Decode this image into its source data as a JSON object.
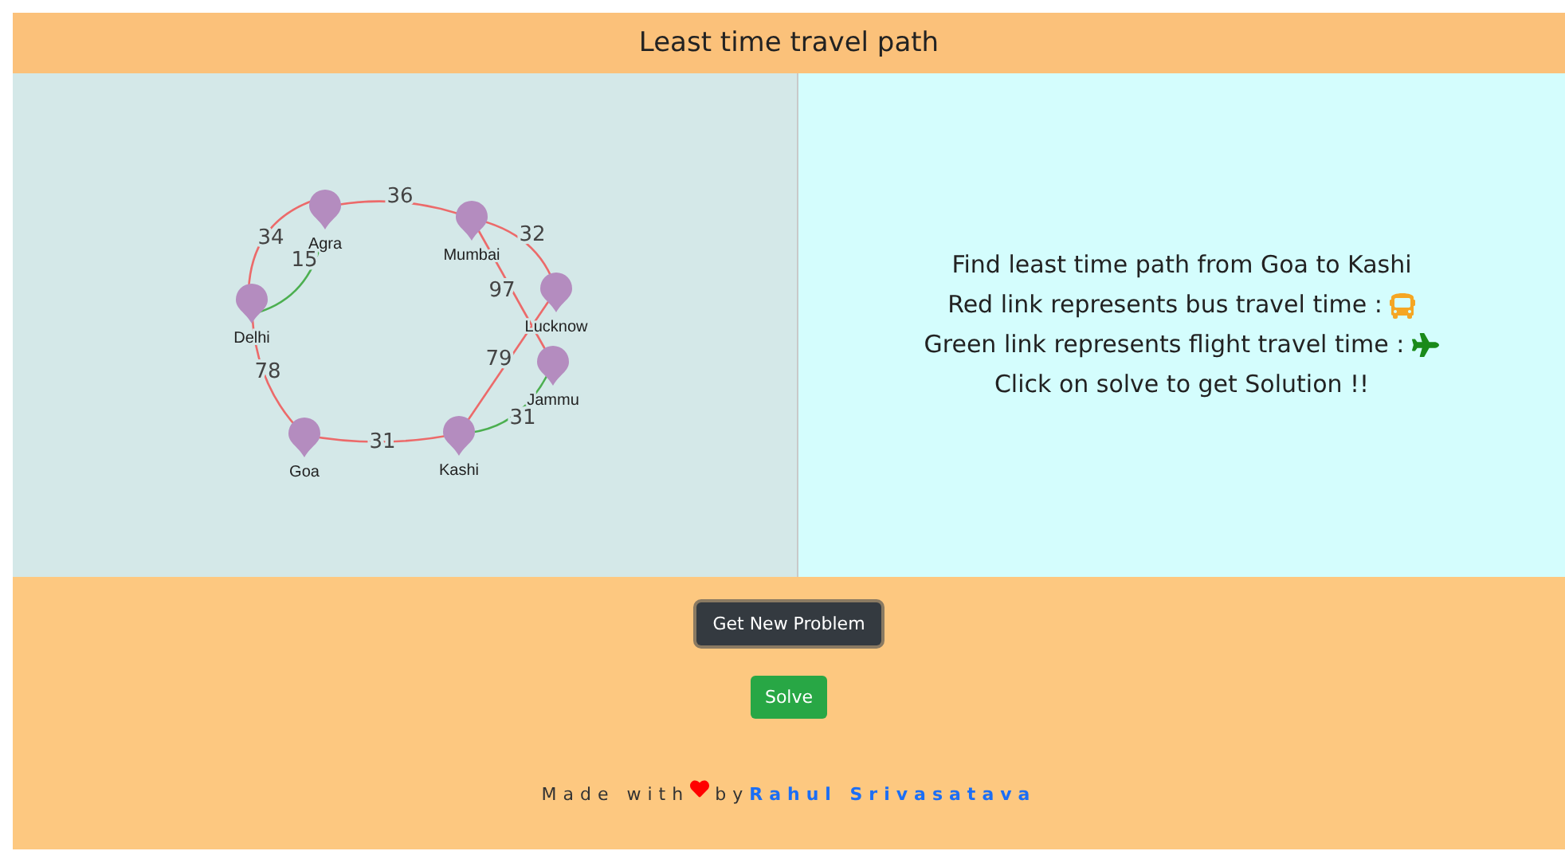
{
  "header": {
    "title": "Least time travel path"
  },
  "graph": {
    "nodes": [
      "Agra",
      "Mumbai",
      "Lucknow",
      "Jammu",
      "Kashi",
      "Goa",
      "Delhi"
    ],
    "links": [
      {
        "weight": "36",
        "kind": "bus"
      },
      {
        "weight": "34",
        "kind": "bus"
      },
      {
        "weight": "15",
        "kind": "flight"
      },
      {
        "weight": "32",
        "kind": "bus"
      },
      {
        "weight": "97",
        "kind": "bus"
      },
      {
        "weight": "79",
        "kind": "bus"
      },
      {
        "weight": "31",
        "kind": "flight"
      },
      {
        "weight": "31",
        "kind": "bus"
      },
      {
        "weight": "78",
        "kind": "bus"
      }
    ]
  },
  "instructions": [
    {
      "text": "Find least time path from Goa to Kashi"
    },
    {
      "text": "Red link represents bus travel time :",
      "kind": "bus"
    },
    {
      "text": "Green link represents flight travel time :",
      "kind": "flight"
    },
    {
      "text": "Click on solve to get Solution !!"
    }
  ],
  "buttons": [
    {
      "label": "Get New Problem",
      "kind": "dark"
    },
    {
      "label": "Solve",
      "kind": "success"
    }
  ],
  "footer": {
    "made_with": "Made with",
    "by": "by",
    "author": "Rahul Srivasatava"
  }
}
